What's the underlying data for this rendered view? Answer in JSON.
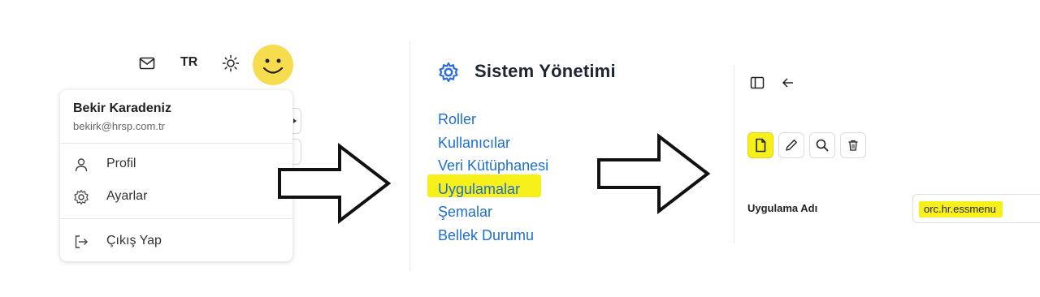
{
  "topbar": {
    "mail_icon": "mail-icon",
    "language": "TR",
    "theme_icon": "sun-icon",
    "avatar_icon": "smiley-avatar"
  },
  "user_menu": {
    "name": "Bekir Karadeniz",
    "email": "bekirk@hrsp.com.tr",
    "items": [
      {
        "label": "Profil",
        "icon": "user-icon"
      },
      {
        "label": "Ayarlar",
        "icon": "gear-icon",
        "highlighted": true
      },
      {
        "label": "Çıkış Yap",
        "icon": "logout-icon"
      }
    ]
  },
  "system_panel": {
    "title": "Sistem Yönetimi",
    "title_icon": "gear-icon",
    "items": [
      {
        "label": "Roller"
      },
      {
        "label": "Kullanıcılar"
      },
      {
        "label": "Veri Kütüphanesi"
      },
      {
        "label": "Uygulamalar",
        "highlighted": true
      },
      {
        "label": "Şemalar"
      },
      {
        "label": "Bellek Durumu"
      }
    ]
  },
  "app_panel": {
    "top_icons": [
      "sidebar-toggle-icon",
      "back-arrow-icon"
    ],
    "toolbar": [
      "new-document-icon",
      "edit-pencil-icon",
      "search-icon",
      "delete-trash-icon"
    ],
    "field_label": "Uygulama Adı",
    "field_value": "orc.hr.essmenu"
  },
  "colors": {
    "highlight": "#f7f01a",
    "link": "#1c6fd1",
    "avatar": "#f7dc4d",
    "gear_icon": "#2a6be0"
  }
}
